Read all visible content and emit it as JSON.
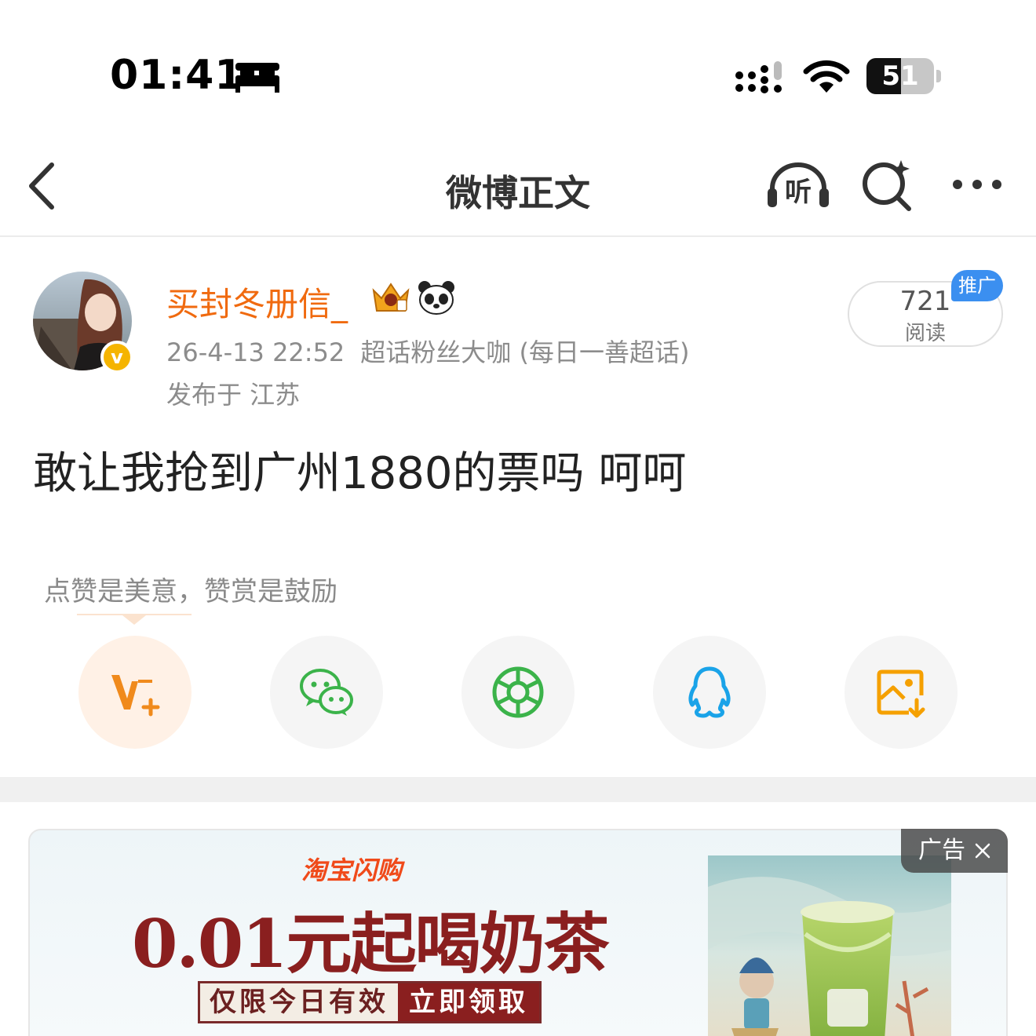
{
  "status_bar": {
    "time": "01:41",
    "battery_level": "51",
    "battery_fraction": 0.51,
    "icons": [
      "bed-icon",
      "signal-icon",
      "wifi-icon",
      "battery-icon"
    ]
  },
  "nav": {
    "title": "微博正文",
    "icons": [
      "back-icon",
      "listen-icon",
      "search-icon",
      "more-icon"
    ],
    "listen_glyph": "听"
  },
  "post": {
    "username": "买封冬册信_",
    "verified_mark": "v",
    "timestamp": "26-4-13 22:52",
    "source": "超话粉丝大咖 (每日一善超话)",
    "location": "发布于 江苏",
    "text": "敢让我抢到广州1880的票吗 呵呵",
    "reads_count": "721",
    "reads_label": "阅读",
    "promo_tag": "推广",
    "username_color": "#f06a0f"
  },
  "reward": {
    "hint": "点赞是美意，赞赏是鼓励"
  },
  "share_buttons": [
    {
      "name": "vplus-reward-icon",
      "color": "#f08a1c"
    },
    {
      "name": "wechat-icon",
      "color": "#3bb34a"
    },
    {
      "name": "moments-icon",
      "color": "#3bb34a"
    },
    {
      "name": "qq-icon",
      "color": "#1aa3e8"
    },
    {
      "name": "save-image-icon",
      "color": "#f5a000"
    }
  ],
  "ad": {
    "label": "广告",
    "brand": "淘宝闪购",
    "headline": "0.01元起喝奶茶",
    "cta_left": "仅限今日有效",
    "cta_right": "立即领取"
  }
}
